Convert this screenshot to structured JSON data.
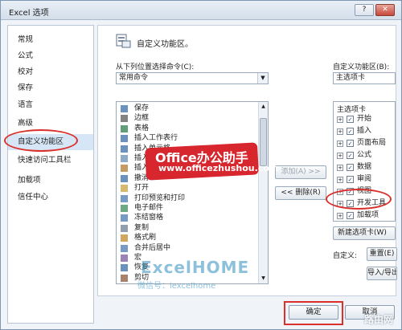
{
  "window": {
    "title": "Excel 选项",
    "help_glyph": "?",
    "close_glyph": "✕"
  },
  "nav": {
    "items": [
      {
        "label": "常规"
      },
      {
        "label": "公式"
      },
      {
        "label": "校对"
      },
      {
        "label": "保存"
      },
      {
        "label": "语言"
      },
      {
        "label": "高级"
      },
      {
        "label": "自定义功能区",
        "selected": true
      },
      {
        "label": "快速访问工具栏"
      },
      {
        "label": "加载项"
      },
      {
        "label": "信任中心"
      }
    ]
  },
  "main": {
    "header_title": "自定义功能区。",
    "left_label": "从下列位置选择命令(C):",
    "left_dropdown": "常用命令",
    "commands": [
      {
        "label": "保存",
        "icon": "save-icon"
      },
      {
        "label": "边框",
        "icon": "border-icon"
      },
      {
        "label": "表格",
        "icon": "table-icon"
      },
      {
        "label": "插入工作表行",
        "icon": "insert-row-icon"
      },
      {
        "label": "插入单元格",
        "icon": "insert-cells-icon"
      },
      {
        "label": "插入",
        "icon": "insert-icon"
      },
      {
        "label": "插入图片",
        "icon": "picture-icon"
      },
      {
        "label": "撤消",
        "icon": "undo-icon"
      },
      {
        "label": "打开",
        "icon": "open-icon"
      },
      {
        "label": "打印预览和打印",
        "icon": "print-preview-icon"
      },
      {
        "label": "电子邮件",
        "icon": "email-icon"
      },
      {
        "label": "冻结窗格",
        "icon": "freeze-panes-icon"
      },
      {
        "label": "复制",
        "icon": "copy-icon"
      },
      {
        "label": "格式刷",
        "icon": "format-painter-icon"
      },
      {
        "label": "合并后居中",
        "icon": "merge-center-icon"
      },
      {
        "label": "宏",
        "icon": "macro-icon"
      },
      {
        "label": "恢复",
        "icon": "redo-icon"
      },
      {
        "label": "剪切",
        "icon": "cut-icon"
      }
    ],
    "add_button": "添加(A) >>",
    "remove_button": "<< 删除(R)",
    "right_label": "自定义功能区(B):",
    "right_dropdown": "主选项卡",
    "tree_header": "主选项卡",
    "tabs": [
      {
        "label": "开始",
        "checked": true
      },
      {
        "label": "插入",
        "checked": true
      },
      {
        "label": "页面布局",
        "checked": true
      },
      {
        "label": "公式",
        "checked": true
      },
      {
        "label": "数据",
        "checked": true
      },
      {
        "label": "审阅",
        "checked": true
      },
      {
        "label": "视图",
        "checked": true
      },
      {
        "label": "开发工具",
        "checked": true
      },
      {
        "label": "加载项",
        "checked": true
      }
    ],
    "new_tab_button": "新建选项卡(W)",
    "customize_label": "自定义:",
    "reset_button": "重置(E)",
    "import_export_button": "导入/导出"
  },
  "footer": {
    "ok_button": "确定",
    "cancel_button": "取消"
  },
  "overlay": {
    "banner_line1": "Office办公助手",
    "banner_line2": "www.officezhushou.com",
    "excelhome": "ExcelHOME",
    "wechat": "微信号：iexcelhome",
    "site": "路由网"
  },
  "colors": {
    "highlight_ring": "#d9302b",
    "banner": "#d7262d",
    "selection": "#d6e6f6"
  }
}
